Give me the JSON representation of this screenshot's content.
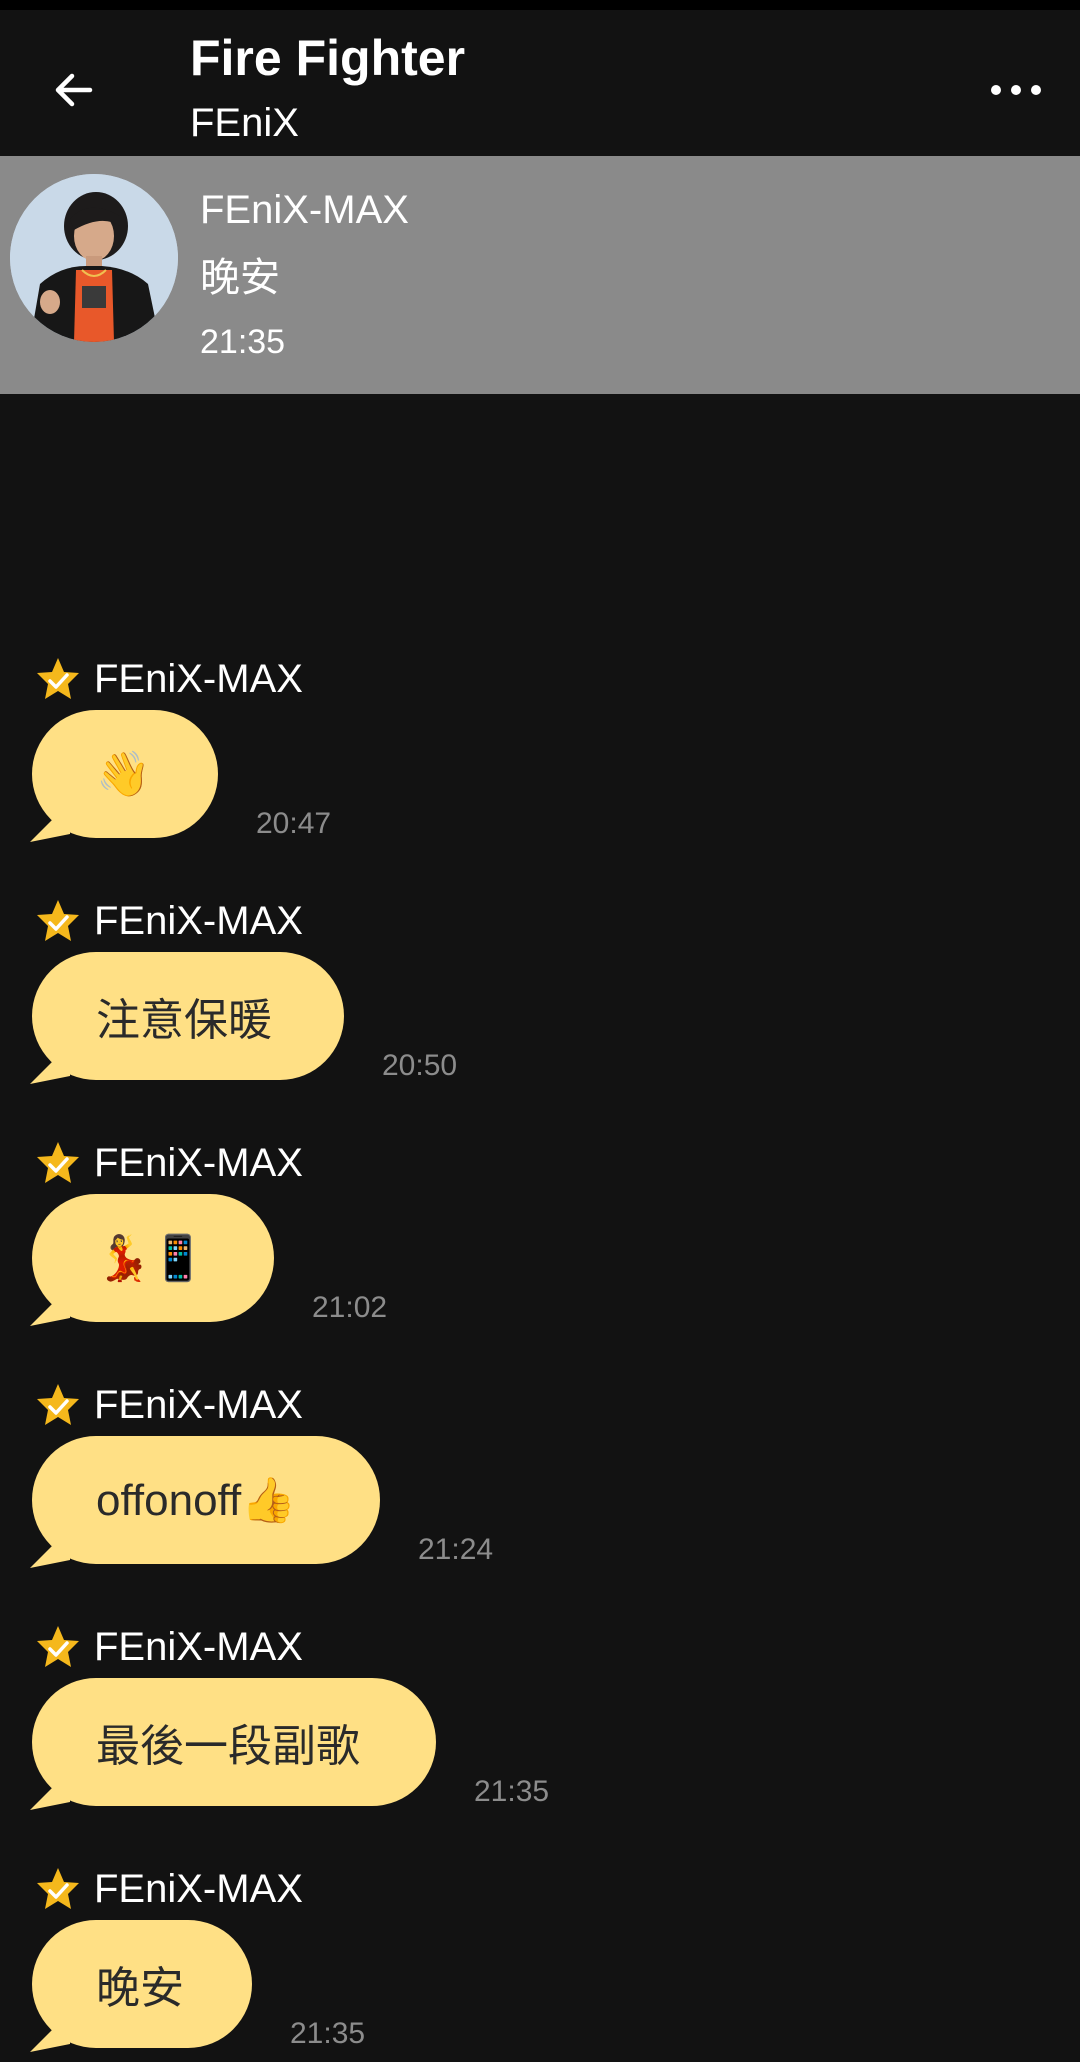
{
  "header": {
    "title": "Fire Fighter",
    "subtitle": "FEniX",
    "back_icon": "arrow-left-icon",
    "more_icon": "more-horizontal-icon"
  },
  "pinned": {
    "sender": "FEniX-MAX",
    "text": "晚安",
    "time": "21:35"
  },
  "colors": {
    "background": "#121212",
    "bubble": "#ffe085",
    "pinned_bg": "#8a8a8a",
    "star": "#f5b81c",
    "timestamp": "#8c8c8c"
  },
  "messages": [
    {
      "sender": "FEniX-MAX",
      "text": "👋",
      "time": "20:47"
    },
    {
      "sender": "FEniX-MAX",
      "text": "注意保暖",
      "time": "20:50"
    },
    {
      "sender": "FEniX-MAX",
      "text": "💃📱",
      "time": "21:02"
    },
    {
      "sender": "FEniX-MAX",
      "text": "offonoff👍",
      "time": "21:24"
    },
    {
      "sender": "FEniX-MAX",
      "text": "最後一段副歌",
      "time": "21:35"
    },
    {
      "sender": "FEniX-MAX",
      "text": "晚安",
      "time": "21:35"
    }
  ]
}
